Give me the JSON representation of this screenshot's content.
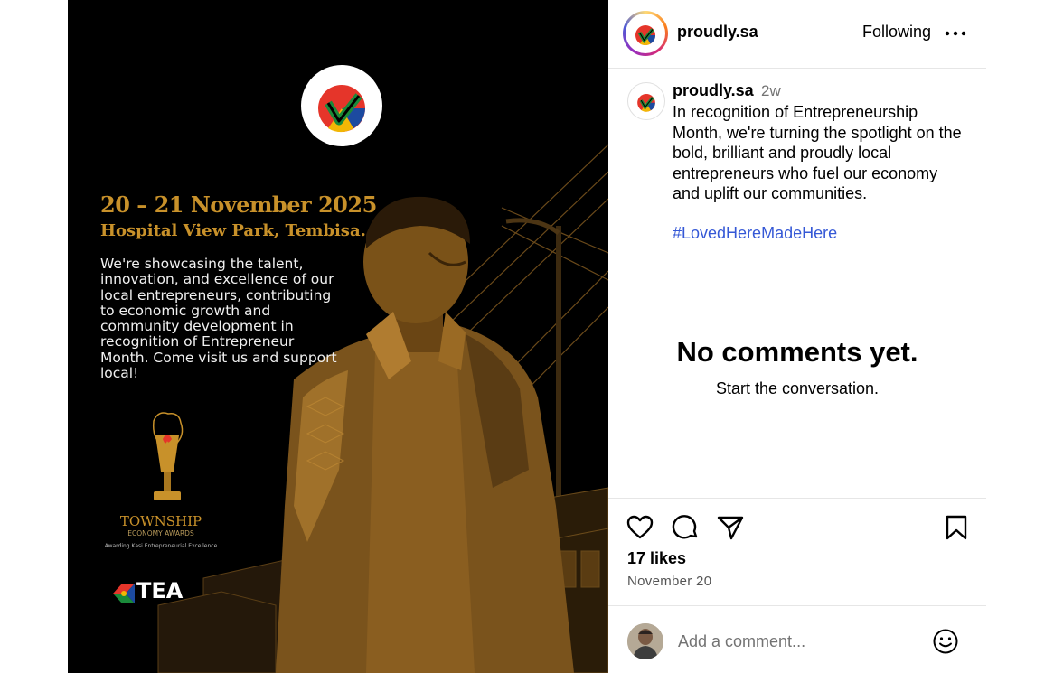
{
  "post_image": {
    "logo_name": "proudly-south-african-logo",
    "event_date": "20 – 21 November 2025",
    "venue": "Hospital View Park, Tembisa.",
    "description": "We're showcasing the talent, innovation, and excellence of our local entrepreneurs, contributing to economic growth and community development in recognition of Entrepreneur Month. Come visit us and support local!",
    "award_title": "TOWNSHIP",
    "award_subtitle": "ECONOMY AWARDS",
    "award_tagline": "Awarding Kasi Entrepreneurial Excellence",
    "partner_logo": "TEA",
    "colors": {
      "gold": "#c8912a",
      "background": "#000000"
    }
  },
  "header": {
    "username": "proudly.sa",
    "follow_label": "Following",
    "more_icon": "more-horizontal-icon"
  },
  "caption": {
    "username": "proudly.sa",
    "time": "2w",
    "text": "In recognition of Entrepreneurship Month, we're turning the spotlight on the bold, brilliant and proudly local entrepreneurs who fuel our economy and uplift our communities.",
    "hashtag": "#LovedHereMadeHere",
    "hashtag_color": "#3558d6"
  },
  "comments": {
    "empty_title": "No comments yet.",
    "empty_subtitle": "Start the conversation."
  },
  "actions": {
    "icons": [
      "heart-icon",
      "comment-icon",
      "share-icon",
      "bookmark-icon"
    ]
  },
  "stats": {
    "likes": "17 likes",
    "date": "November 20"
  },
  "comment_box": {
    "placeholder": "Add a comment...",
    "emoji_icon": "smiley-icon"
  }
}
